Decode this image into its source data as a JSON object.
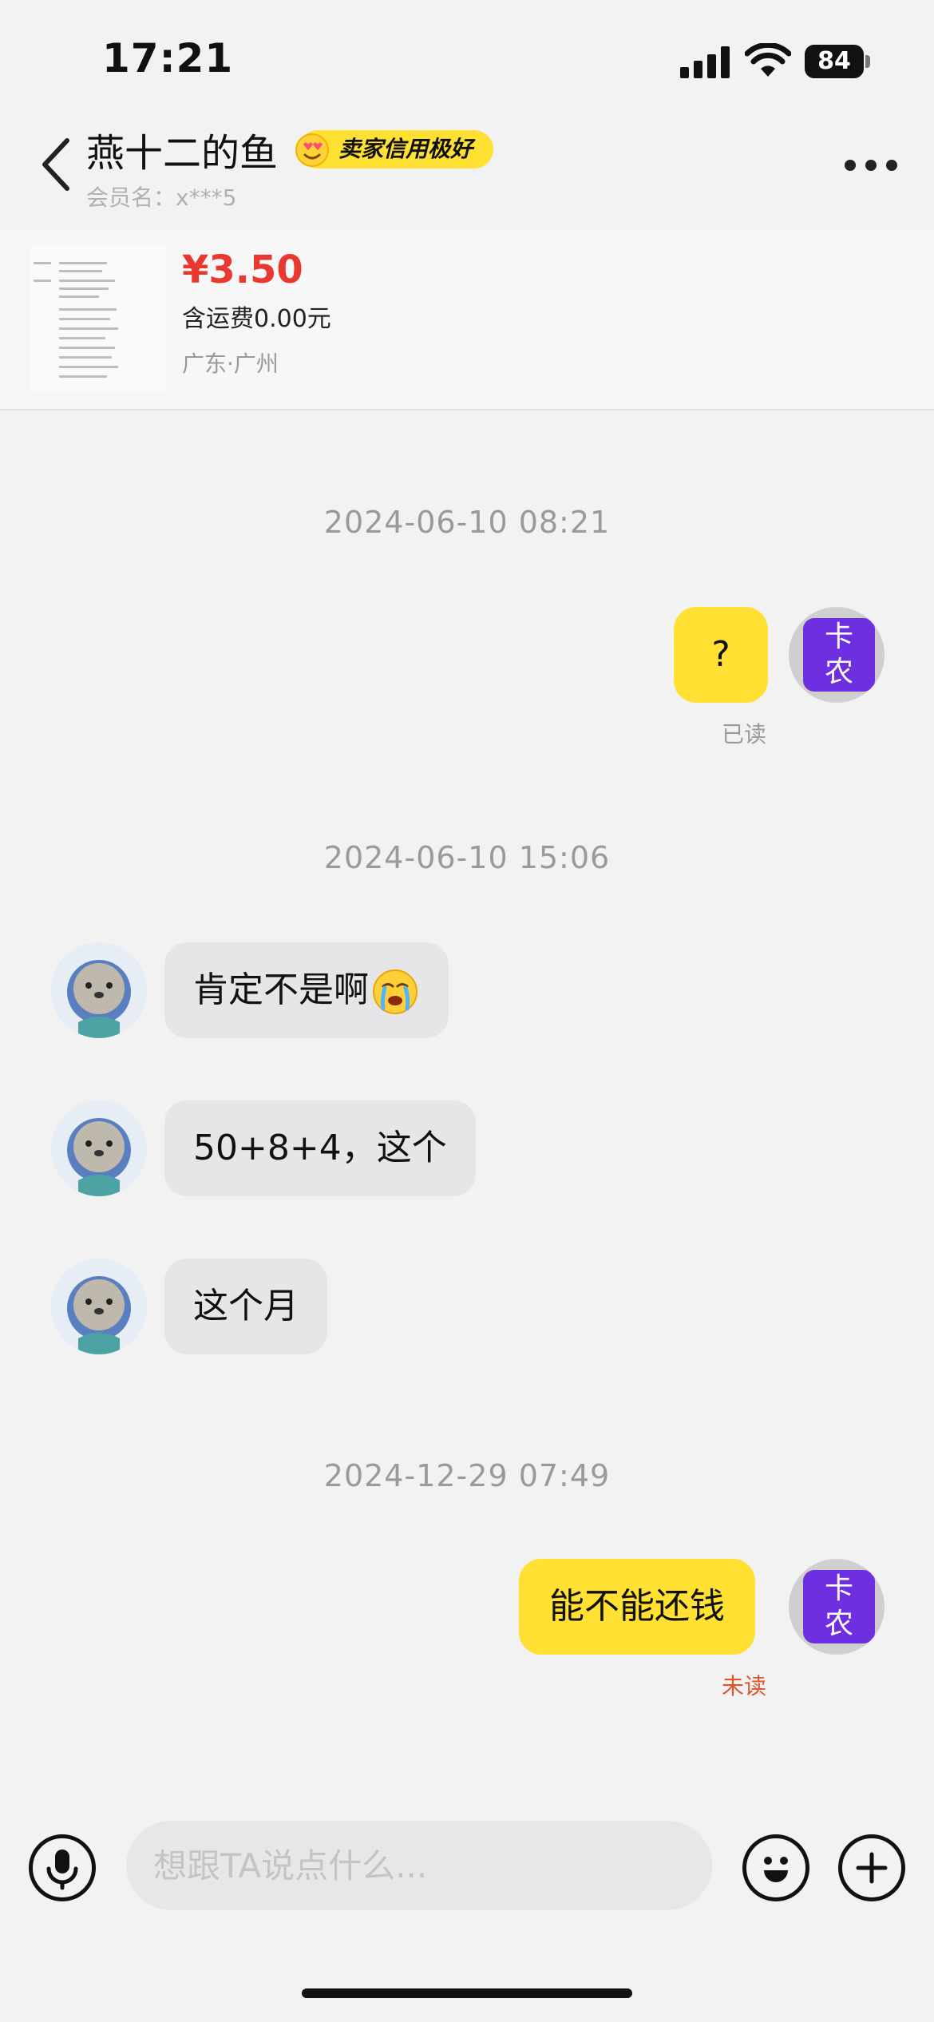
{
  "status_bar": {
    "time": "17:21",
    "battery": "84"
  },
  "header": {
    "seller_name": "燕十二的鱼",
    "credit_badge": "卖家信用极好",
    "member_label": "会员名：",
    "member_id": "x***5"
  },
  "product": {
    "price": "¥3.50",
    "shipping": "含运费0.00元",
    "location": "广东·广州"
  },
  "chat": {
    "timestamps": [
      "2024-06-10 08:21",
      "2024-06-10 15:06",
      "2024-12-29 07:49"
    ],
    "my_avatar_text": [
      "卡",
      "农"
    ],
    "messages": [
      {
        "from": "me",
        "text": "?",
        "status": "已读"
      },
      {
        "from": "them",
        "text": "肯定不是啊"
      },
      {
        "from": "them",
        "text": "50+8+4，这个"
      },
      {
        "from": "them",
        "text": "这个月"
      },
      {
        "from": "me",
        "text": "能不能还钱",
        "status": "未读"
      }
    ]
  },
  "input": {
    "placeholder": "想跟TA说点什么..."
  },
  "colors": {
    "accent_yellow": "#ffe033",
    "price_red": "#e8382f",
    "unread_orange": "#e0542b",
    "read_gray": "#9a9a9a",
    "avatar_purple": "#6e2fe0"
  },
  "icons": [
    "back-icon",
    "more-icon",
    "signal-icon",
    "wifi-icon",
    "battery-icon",
    "mic-icon",
    "emoji-icon",
    "plus-icon",
    "crying-emoji-icon",
    "seal-avatar-icon"
  ]
}
